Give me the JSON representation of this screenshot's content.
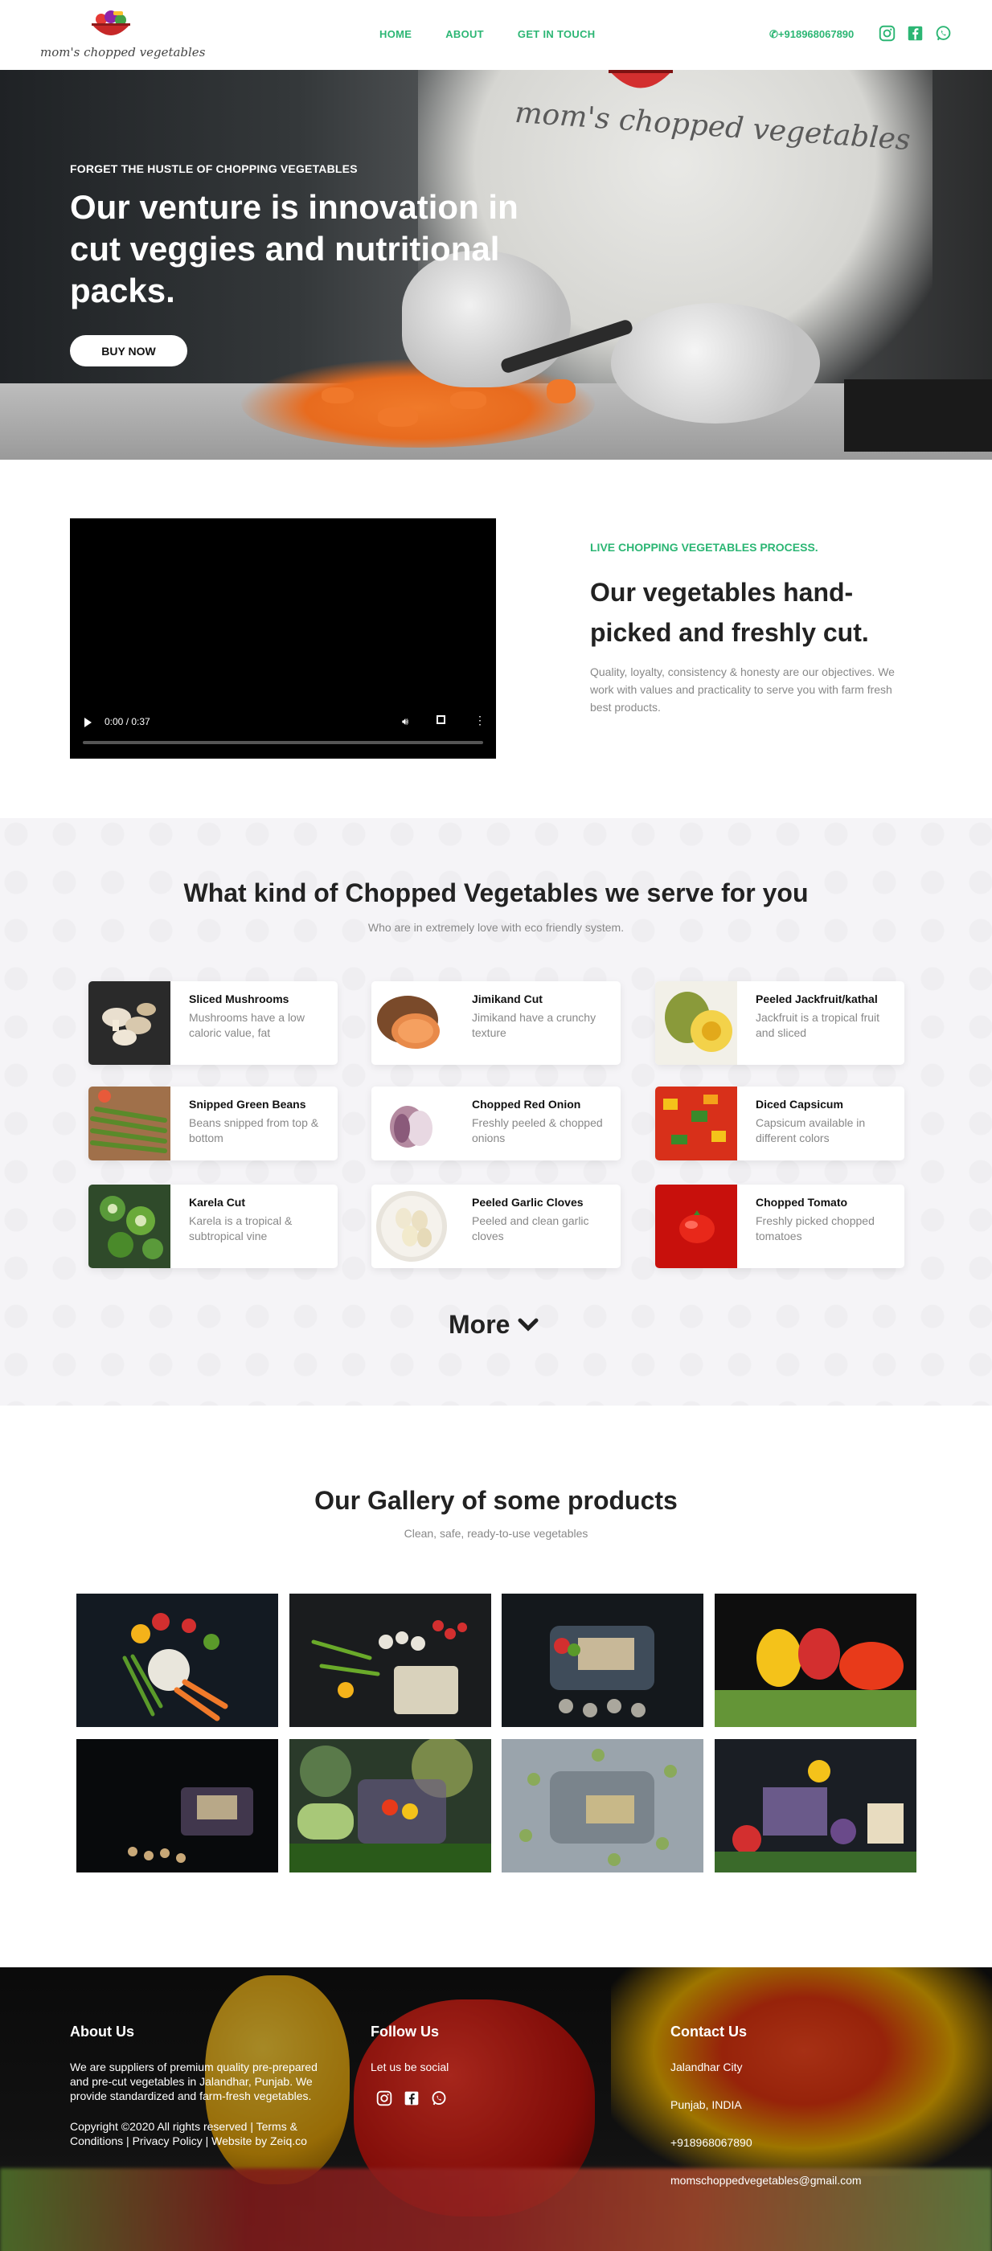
{
  "header": {
    "logo_text": "mom's chopped vegetables",
    "nav": [
      "HOME",
      "ABOUT",
      "GET IN TOUCH"
    ],
    "phone": "+918968067890",
    "social_icons": [
      "instagram-icon",
      "facebook-icon",
      "whatsapp-icon"
    ]
  },
  "hero": {
    "shirt_text": "mom's chopped vegetables",
    "kicker": "FORGET THE HUSTLE OF CHOPPING VEGETABLES",
    "title": "Our venture is innovation in cut veggies and nutritional packs.",
    "cta": "BUY NOW"
  },
  "intro": {
    "video_time": "0:00 / 0:37",
    "kicker": "LIVE CHOPPING VEGETABLES PROCESS.",
    "title": "Our vegetables hand-picked and freshly cut.",
    "text": "Quality, loyalty, consistency & honesty are our objectives. We work with values and practicality to serve you with farm fresh best products."
  },
  "products": {
    "title": "What kind of Chopped Vegetables we serve for you",
    "subtitle": "Who are in extremely love with eco friendly system.",
    "items": [
      {
        "name": "Sliced Mushrooms",
        "desc": "Mushrooms have a low caloric value, fat"
      },
      {
        "name": "Jimikand Cut",
        "desc": "Jimikand have a crunchy texture"
      },
      {
        "name": "Peeled Jackfruit/kathal",
        "desc": "Jackfruit is a tropical fruit and sliced"
      },
      {
        "name": "Snipped Green Beans",
        "desc": "Beans snipped from top & bottom"
      },
      {
        "name": "Chopped Red Onion",
        "desc": "Freshly peeled & chopped onions"
      },
      {
        "name": "Diced Capsicum",
        "desc": "Capsicum available in different colors"
      },
      {
        "name": "Karela Cut",
        "desc": "Karela is a tropical & subtropical vine"
      },
      {
        "name": "Peeled Garlic Cloves",
        "desc": "Peeled and clean garlic cloves"
      },
      {
        "name": "Chopped Tomato",
        "desc": "Freshly picked chopped tomatoes"
      }
    ],
    "more": "More"
  },
  "gallery": {
    "title": "Our Gallery of some products",
    "subtitle": "Clean, safe, ready-to-use vegetables"
  },
  "footer": {
    "about_title": "About Us",
    "about_text": "We are suppliers of premium quality pre-prepared and pre-cut vegetables in Jalandhar, Punjab. We provide standardized and farm-fresh vegetables.",
    "copyright": "Copyright ©2020 All rights reserved | Terms & Conditions | Privacy Policy | Website by Zeiq.co",
    "follow_title": "Follow Us",
    "follow_text": "Let us be social",
    "contact_title": "Contact Us",
    "city": "Jalandhar City",
    "state": "Punjab, INDIA",
    "phone": "+918968067890",
    "email": "momschoppedvegetables@gmail.com"
  },
  "colors": {
    "accent": "#2cb674",
    "text": "#222222",
    "muted": "#888888",
    "section_bg": "#f5f4f7"
  }
}
